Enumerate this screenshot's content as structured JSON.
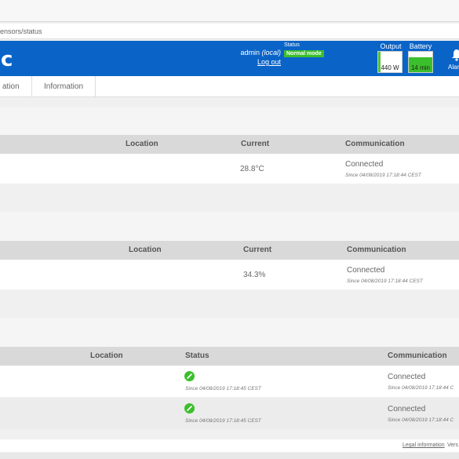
{
  "browser": {
    "url": "ensors/status"
  },
  "header": {
    "logo": "c",
    "user_name": "admin",
    "user_scope": "(local)",
    "logout": "Log out",
    "status_label": "Status",
    "status_value": "Normal mode",
    "output_label": "Output",
    "output_value": "440 W",
    "output_level": 0.1,
    "battery_label": "Battery",
    "battery_value": "14 min",
    "battery_level": 0.75,
    "alarms_label": "Alar",
    "accent": "#0a64c8",
    "ok_color": "#3cbf2c"
  },
  "tabs": [
    {
      "label": "ation"
    },
    {
      "label": "Information"
    }
  ],
  "temperature": {
    "headers": {
      "location": "Location",
      "current": "Current",
      "communication": "Communication"
    },
    "rows": [
      {
        "current": "28.8°C",
        "comm": "Connected",
        "since": "Since 04/08/2019 17:18:44 CEST"
      }
    ]
  },
  "humidity": {
    "headers": {
      "location": "Location",
      "current": "Current",
      "communication": "Communication"
    },
    "rows": [
      {
        "current": "34.3%",
        "comm": "Connected",
        "since": "Since 04/08/2019 17:18:44 CEST"
      }
    ]
  },
  "contacts": {
    "headers": {
      "location": "Location",
      "status": "Status",
      "communication": "Communication"
    },
    "rows": [
      {
        "status_icon": "check-icon",
        "status_since": "Since 04/08/2019 17:18:45 CEST",
        "comm": "Connected",
        "since": "Since 04/08/2019 17:18:44 C"
      },
      {
        "status_icon": "check-icon",
        "status_since": "Since 04/08/2019 17:18:45 CEST",
        "comm": "Connected",
        "since": "Since 04/08/2019 17:18:44 C"
      }
    ]
  },
  "footer": {
    "legal": "Legal information",
    "version": "Vers"
  }
}
